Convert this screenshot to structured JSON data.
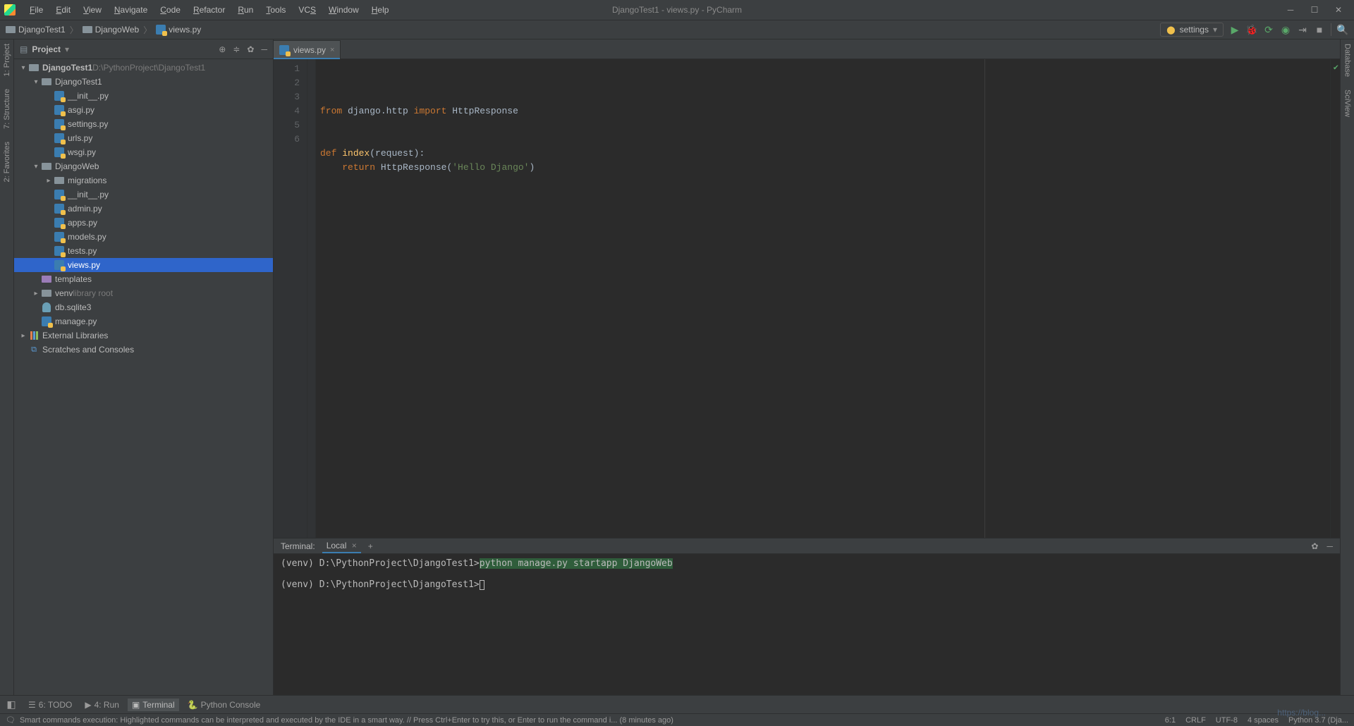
{
  "window_title": "DjangoTest1 - views.py - PyCharm",
  "menu": [
    "File",
    "Edit",
    "View",
    "Navigate",
    "Code",
    "Refactor",
    "Run",
    "Tools",
    "VCS",
    "Window",
    "Help"
  ],
  "menu_underline_idx": [
    0,
    0,
    0,
    0,
    0,
    0,
    0,
    0,
    2,
    0,
    0
  ],
  "breadcrumb": [
    {
      "label": "DjangoTest1",
      "icon": "folder"
    },
    {
      "label": "DjangoWeb",
      "icon": "folder"
    },
    {
      "label": "views.py",
      "icon": "py"
    }
  ],
  "run_config": "settings",
  "project_panel": {
    "title": "Project",
    "tree": [
      {
        "d": 0,
        "exp": "open",
        "icon": "folder",
        "label": "DjangoTest1",
        "suffix": "D:\\PythonProject\\DjangoTest1",
        "bold": true
      },
      {
        "d": 1,
        "exp": "open",
        "icon": "folder",
        "label": "DjangoTest1"
      },
      {
        "d": 2,
        "exp": "",
        "icon": "py",
        "label": "__init__.py"
      },
      {
        "d": 2,
        "exp": "",
        "icon": "py",
        "label": "asgi.py"
      },
      {
        "d": 2,
        "exp": "",
        "icon": "py",
        "label": "settings.py"
      },
      {
        "d": 2,
        "exp": "",
        "icon": "py",
        "label": "urls.py"
      },
      {
        "d": 2,
        "exp": "",
        "icon": "py",
        "label": "wsgi.py"
      },
      {
        "d": 1,
        "exp": "open",
        "icon": "folder",
        "label": "DjangoWeb"
      },
      {
        "d": 2,
        "exp": "closed",
        "icon": "folder",
        "label": "migrations"
      },
      {
        "d": 2,
        "exp": "",
        "icon": "py",
        "label": "__init__.py"
      },
      {
        "d": 2,
        "exp": "",
        "icon": "py",
        "label": "admin.py"
      },
      {
        "d": 2,
        "exp": "",
        "icon": "py",
        "label": "apps.py"
      },
      {
        "d": 2,
        "exp": "",
        "icon": "py",
        "label": "models.py"
      },
      {
        "d": 2,
        "exp": "",
        "icon": "py",
        "label": "tests.py"
      },
      {
        "d": 2,
        "exp": "",
        "icon": "py",
        "label": "views.py",
        "sel": true
      },
      {
        "d": 1,
        "exp": "",
        "icon": "folder-purple",
        "label": "templates"
      },
      {
        "d": 1,
        "exp": "closed",
        "icon": "folder",
        "label": "venv",
        "suffix": "library root"
      },
      {
        "d": 1,
        "exp": "",
        "icon": "db",
        "label": "db.sqlite3"
      },
      {
        "d": 1,
        "exp": "",
        "icon": "py",
        "label": "manage.py"
      },
      {
        "d": 0,
        "exp": "closed",
        "icon": "lib",
        "label": "External Libraries"
      },
      {
        "d": 0,
        "exp": "",
        "icon": "scratch",
        "label": "Scratches and Consoles"
      }
    ]
  },
  "tabs": [
    {
      "label": "views.py",
      "icon": "py",
      "active": true
    }
  ],
  "code": {
    "lines": [
      [
        {
          "t": "from ",
          "c": "kw"
        },
        {
          "t": "django.http "
        },
        {
          "t": "import ",
          "c": "kw"
        },
        {
          "t": "HttpResponse"
        }
      ],
      [],
      [],
      [
        {
          "t": "def ",
          "c": "kw"
        },
        {
          "t": "index",
          "c": "fn"
        },
        {
          "t": "(request):"
        }
      ],
      [
        {
          "t": "    "
        },
        {
          "t": "return ",
          "c": "kw"
        },
        {
          "t": "HttpResponse("
        },
        {
          "t": "'Hello Django'",
          "c": "str"
        },
        {
          "t": ")"
        }
      ],
      []
    ],
    "ruler_col": 120
  },
  "terminal": {
    "label": "Terminal:",
    "tab": "Local",
    "lines": [
      {
        "prompt": "(venv) D:\\PythonProject\\DjangoTest1>",
        "cmd": "python manage.py startapp DjangoWeb",
        "hl": true
      },
      {
        "prompt": "",
        "cmd": ""
      },
      {
        "prompt": "(venv) D:\\PythonProject\\DjangoTest1>",
        "cursor": true
      }
    ]
  },
  "bottom_bar": [
    {
      "icon": "☰",
      "label": "6: TODO"
    },
    {
      "icon": "▶",
      "label": "4: Run"
    },
    {
      "icon": "▣",
      "label": "Terminal",
      "active": true
    },
    {
      "icon": "🐍",
      "label": "Python Console"
    }
  ],
  "status": {
    "msg": "Smart commands execution: Highlighted commands can be interpreted and executed by the IDE in a smart way. // Press Ctrl+Enter to try this, or Enter to run the command i... (8 minutes ago)",
    "right": [
      "6:1",
      "CRLF",
      "UTF-8",
      "4 spaces",
      "Python 3.7 (Dja..."
    ]
  },
  "left_rail": [
    "1: Project",
    "7: Structure",
    "2: Favorites"
  ],
  "right_rail": [
    "Database",
    "SciView"
  ],
  "watermark": "https://blog..."
}
